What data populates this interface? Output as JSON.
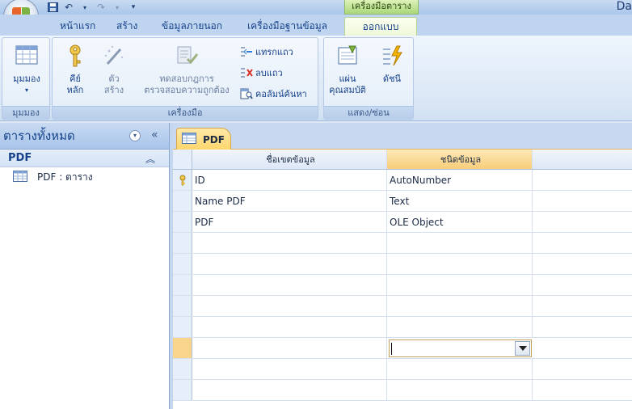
{
  "window": {
    "app_title": "Da",
    "contextual_tools_label": "เครื่องมือตาราง"
  },
  "tabs": [
    {
      "label": "หน้าแรก"
    },
    {
      "label": "สร้าง"
    },
    {
      "label": "ข้อมูลภายนอก"
    },
    {
      "label": "เครื่องมือฐานข้อมูล"
    },
    {
      "label": "ออกแบบ"
    }
  ],
  "ribbon": {
    "groups": {
      "views": "มุมมอง",
      "tools": "เครื่องมือ",
      "show_hide": "แสดง/ซ่อน"
    },
    "buttons": {
      "view": "มุมมอง",
      "primary_key_line1": "คีย์",
      "primary_key_line2": "หลัก",
      "builder_line1": "ตัว",
      "builder_line2": "สร้าง",
      "test_rules_line1": "ทดสอบกฎการ",
      "test_rules_line2": "ตรวจสอบความถูกต้อง",
      "insert_rows": "แทรกแถว",
      "delete_rows": "ลบแถว",
      "lookup_column": "คอลัมน์ค้นหา",
      "property_sheet_line1": "แผ่น",
      "property_sheet_line2": "คุณสมบัติ",
      "indexes": "ดัชนี"
    }
  },
  "nav_pane": {
    "title": "ตารางทั้งหมด",
    "group": "PDF",
    "items": [
      {
        "label": "PDF : ตาราง"
      }
    ]
  },
  "document": {
    "tab_label": "PDF",
    "columns": {
      "field_name": "ชื่อเขตข้อมูล",
      "data_type": "ชนิดข้อมูล"
    },
    "rows": [
      {
        "name": "ID",
        "type": "AutoNumber",
        "key": true
      },
      {
        "name": "Name PDF",
        "type": "Text",
        "key": false
      },
      {
        "name": "PDF",
        "type": "OLE Object",
        "key": false
      }
    ]
  }
}
